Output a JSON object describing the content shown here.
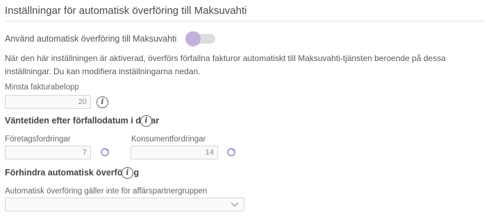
{
  "section": {
    "title": "Inställningar för automatisk överföring till Maksuvahti"
  },
  "toggle": {
    "label": "Använd automatisk överföring till Maksuvahti",
    "enabled": true,
    "knob_color": "#c4b0dc"
  },
  "description": "När den här inställningen är aktiverad, överförs förfallna fakturor automatiskt till Maksuvahti-tjänsten beroende på dessa inställningar. Du kan modifiera inställningarna nedan.",
  "min_amount": {
    "label": "Minsta fakturabelopp",
    "value": "20"
  },
  "wait_time": {
    "heading": "Väntetiden efter förfallodatum i dagar",
    "company": {
      "label": "Företagsfordringar",
      "value": "7"
    },
    "consumer": {
      "label": "Konsumentfordringar",
      "value": "14"
    }
  },
  "prevent": {
    "heading": "Förhindra automatisk överföring",
    "select_label": "Automatisk överföring gäller inte för affärspartnergruppen",
    "select_value": ""
  },
  "icons": {
    "info": "i"
  },
  "colors": {
    "accent": "#c4b0dc",
    "refresh": "#8c7fc8"
  }
}
